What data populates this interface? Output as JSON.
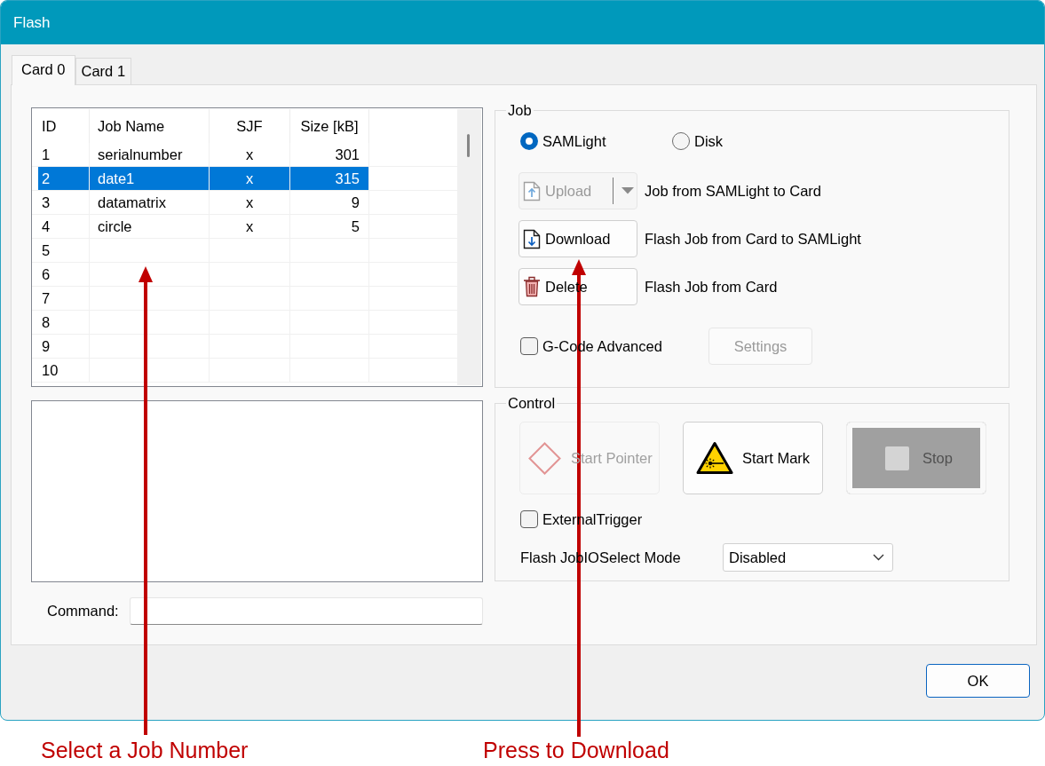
{
  "window": {
    "title": "Flash"
  },
  "tabs": [
    {
      "label": "Card 0",
      "selected": true
    },
    {
      "label": "Card 1",
      "selected": false
    }
  ],
  "jobs_table": {
    "columns": [
      "ID",
      "Job Name",
      "SJF",
      "Size [kB]"
    ],
    "rows": [
      {
        "cells": [
          "1",
          "serialnumber",
          "x",
          "301"
        ],
        "selected": false
      },
      {
        "cells": [
          "2",
          "date1",
          "x",
          "315"
        ],
        "selected": true
      },
      {
        "cells": [
          "3",
          "datamatrix",
          "x",
          "9"
        ],
        "selected": false
      },
      {
        "cells": [
          "4",
          "circle",
          "x",
          "5"
        ],
        "selected": false
      },
      {
        "cells": [
          "5"
        ],
        "selected": false
      },
      {
        "cells": [
          "6"
        ],
        "selected": false
      },
      {
        "cells": [
          "7"
        ],
        "selected": false
      },
      {
        "cells": [
          "8"
        ],
        "selected": false
      },
      {
        "cells": [
          "9"
        ],
        "selected": false
      },
      {
        "cells": [
          "10"
        ],
        "selected": false
      }
    ]
  },
  "command": {
    "label": "Command:"
  },
  "job_group": {
    "title": "Job",
    "source_options": [
      {
        "label": "SAMLight",
        "selected": true
      },
      {
        "label": "Disk",
        "selected": false
      }
    ],
    "actions": [
      {
        "kind": "split",
        "label": "Upload",
        "description": "Job from SAMLight to Card",
        "disabled": true
      },
      {
        "kind": "plain",
        "label": "Download",
        "description": "Flash Job from Card to SAMLight",
        "disabled": false
      },
      {
        "kind": "plain",
        "label": "Delete",
        "description": "Flash Job from Card",
        "disabled": false
      }
    ],
    "g_code_advanced": {
      "label": "G-Code Advanced",
      "checked": false
    },
    "settings_button": {
      "label": "Settings",
      "disabled": true
    }
  },
  "control_group": {
    "title": "Control",
    "buttons": [
      {
        "label": "Start Pointer",
        "disabled": true
      },
      {
        "label": "Start Mark",
        "disabled": false
      },
      {
        "label": "Stop",
        "disabled": true
      }
    ],
    "external_trigger": {
      "label": "ExternalTrigger",
      "checked": false
    },
    "io_select_mode": {
      "label": "Flash JobIOSelect Mode",
      "value": "Disabled"
    }
  },
  "ok_button": {
    "label": "OK"
  },
  "annotations": [
    {
      "text": "Select a Job Number"
    },
    {
      "text": "Press to Download"
    }
  ]
}
